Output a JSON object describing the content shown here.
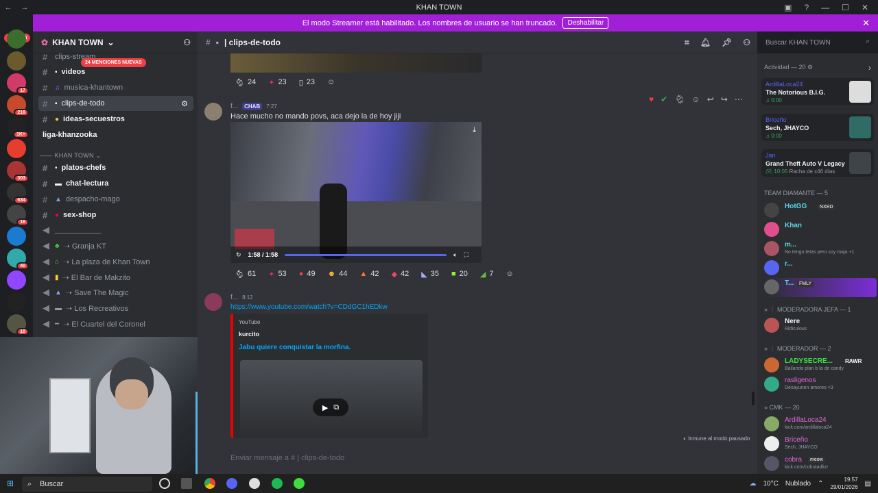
{
  "window": {
    "title": "KHAN TOWN"
  },
  "rail": {
    "new_label": "NUEVO",
    "badges": [
      "17",
      "216",
      "1K+",
      "303",
      "634",
      "16",
      "40",
      "18"
    ]
  },
  "banner": {
    "text": "El modo Streamer está habilitado. Los nombres de usuario se han truncado.",
    "button": "Deshabilitar"
  },
  "sidebar": {
    "server": "KHAN TOWN",
    "mentions": "24 MENCIONES NUEVAS",
    "channels": [
      {
        "name": "clips-stream"
      },
      {
        "name": "videos"
      },
      {
        "name": "musica-khantown"
      },
      {
        "name": "clips-de-todo"
      },
      {
        "name": "ideas-secuestros"
      },
      {
        "name": "liga-khanzooka"
      }
    ],
    "category": "KHAN TOWN",
    "channels2": [
      {
        "name": "platos-chefs"
      },
      {
        "name": "chat-lectura"
      },
      {
        "name": "despacho-mago"
      },
      {
        "name": "sex-shop"
      },
      {
        "name": "___________"
      },
      {
        "name": "➝ Granja KT"
      },
      {
        "name": "➝ La plaza de Khan Town"
      },
      {
        "name": "➝ El Bar de Makzito"
      },
      {
        "name": "➝ Save The Magic"
      },
      {
        "name": "➝ Los Recreativos"
      },
      {
        "name": "➝ El Cuartel del Coronel"
      }
    ]
  },
  "channel": {
    "name": "clips-de-todo"
  },
  "search": {
    "placeholder": "Buscar KHAN TOWN"
  },
  "messages": {
    "top_reactions": [
      "24",
      "23",
      "23"
    ],
    "m1": {
      "author": "f...",
      "tag": "CHAB",
      "time": "7:27",
      "text": "Hace mucho no mando povs, aca dejo la de hoy jiji",
      "video_time": "1:58 / 1:58"
    },
    "m1_reactions": [
      "61",
      "53",
      "49",
      "44",
      "42",
      "42",
      "35",
      "20",
      "7"
    ],
    "m2": {
      "author": "f...",
      "time": "8:12",
      "link": "https://www.youtube.com/watch?v=CDdGC1hEDkw",
      "embed_provider": "YouTube",
      "embed_author": "kurcito",
      "embed_title": "Jabu quiere conquistar la morfina."
    }
  },
  "input": {
    "placeholder": "Enviar mensaje a #   |  clips-de-todo",
    "paused": "Inmune al modo pausado"
  },
  "members": {
    "activity_label": "Actividad — 20",
    "activities": [
      {
        "user": "ArdillaLoca24",
        "title": "The Notorious B.I.G.",
        "time": "0:00"
      },
      {
        "user": "Briceño",
        "title": "Sech, JHAYCO",
        "time": "0:00"
      },
      {
        "user": "Jan",
        "title": "Grand Theft Auto V Legacy",
        "time": "10:05",
        "extra": "Racha de x46 días"
      }
    ],
    "team_label": "TEAM DIAMANTE — 5",
    "team": [
      {
        "name": "HotGG",
        "status": "",
        "tag": "NXED"
      },
      {
        "name": "Khan",
        "status": ""
      },
      {
        "name": "m...",
        "status": "No tengo tetas pero soy maja +1"
      },
      {
        "name": "r...",
        "status": ""
      },
      {
        "name": "T...",
        "status": "",
        "tag": "FMLY"
      }
    ],
    "mod_jefa_label": "MODERADORA JEFA — 1",
    "mod_jefa": [
      {
        "name": "Nere",
        "status": "Ridiculous"
      }
    ],
    "mod_label": "MODERADOR — 2",
    "mods": [
      {
        "name": "LADYSECRE...",
        "status": "Bailando plan b la de candy",
        "tag": "RAWR"
      },
      {
        "name": "rasligenos",
        "status": "Desayunen amores <3"
      }
    ],
    "cmk_label": "CMK — 20",
    "cmk": [
      {
        "name": "ArdillaLoca24",
        "status": "kick.com/ardillaloca24"
      },
      {
        "name": "Briceño",
        "status": "Sech, JHAYCO"
      },
      {
        "name": "cobra",
        "status": "kick.com/cobraadlizr",
        "tag": "meow"
      }
    ]
  },
  "taskbar": {
    "search": "Buscar",
    "weather": "10°C",
    "weather_desc": "Nublado",
    "time": "19:57",
    "date": "29/01/2026"
  },
  "colors": {
    "banner": "#a11fd6",
    "accent": "#5865f2",
    "danger": "#f23f43"
  }
}
